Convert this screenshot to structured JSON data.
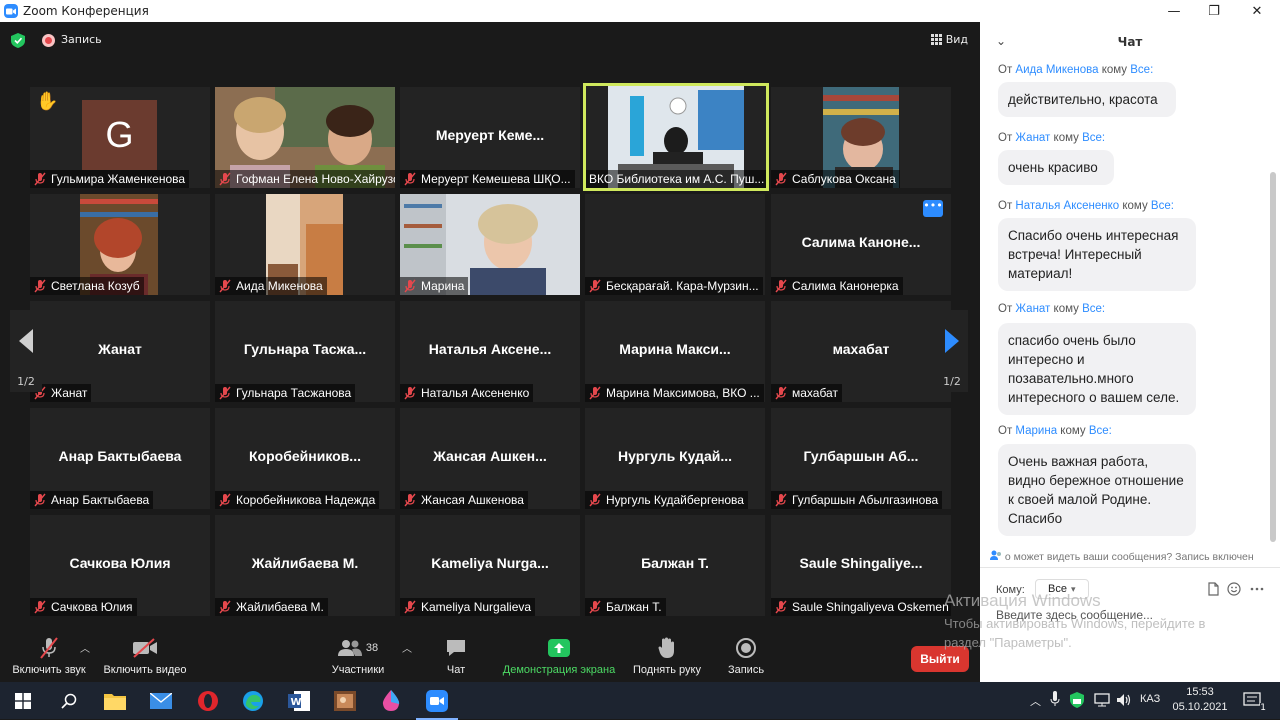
{
  "window": {
    "title": "Zoom Конференция",
    "minimize": "—",
    "maximize": "❐",
    "close": "✕"
  },
  "topbar": {
    "record_label": "Запись",
    "view_label": "Вид"
  },
  "tiles": [
    {
      "label": "Гульмира Жаменкенова",
      "avatar_letter": "G"
    },
    {
      "label": "Гофман Елена Ново-Хайрузо..."
    },
    {
      "big_name": "Меруерт Кеме...",
      "label": "Меруерт Кемешева ШҚО..."
    },
    {
      "label": "ВКО Библиотека им А.С. Пуш..."
    },
    {
      "label": "Саблукова Оксана"
    },
    {
      "label": "Светлана Козуб"
    },
    {
      "label": "Аида Микенова"
    },
    {
      "label": "Марина"
    },
    {
      "label": "Бесқарағай. Кара-Мурзин..."
    },
    {
      "big_name": "Салима Каноне...",
      "label": "Салима Канонерка"
    },
    {
      "big_name": "Жанат",
      "label": "Жанат"
    },
    {
      "big_name": "Гульнара Тасжа...",
      "label": "Гульнара Тасжанова"
    },
    {
      "big_name": "Наталья Аксене...",
      "label": "Наталья Аксененко"
    },
    {
      "big_name": "Марина Макси...",
      "label": "Марина Максимова, ВКО ..."
    },
    {
      "big_name": "махабат",
      "label": "махабат"
    },
    {
      "big_name": "Анар Бактыбаева",
      "label": "Анар Бактыбаева"
    },
    {
      "big_name": "Коробейников...",
      "label": "Коробейникова Надежда"
    },
    {
      "big_name": "Жансая Ашкен...",
      "label": "Жансая Ашкенова"
    },
    {
      "big_name": "Нургуль Кудай...",
      "label": "Нургуль Кудайбергенова"
    },
    {
      "big_name": "Гулбаршын Аб...",
      "label": "Гулбаршын Абылгазинова"
    },
    {
      "big_name": "Сачкова Юлия",
      "label": "Сачкова Юлия"
    },
    {
      "big_name": "Жайлибаева М.",
      "label": "Жайлибаева М."
    },
    {
      "big_name": "Kameliya Nurga...",
      "label": "Kameliya Nurgalieva"
    },
    {
      "big_name": "Балжан Т.",
      "label": "Балжан Т."
    },
    {
      "big_name": "Saule Shingaliye...",
      "label": "Saule Shingaliyeva Oskemen"
    }
  ],
  "pager": {
    "left": "1/2",
    "right": "1/2"
  },
  "toolbar": {
    "unmute": "Включить звук",
    "start_video": "Включить видео",
    "participants": "Участники",
    "participants_count": "38",
    "chat": "Чат",
    "share": "Демонстрация экрана",
    "raise_hand": "Поднять руку",
    "record": "Запись",
    "leave": "Выйти"
  },
  "chat": {
    "title": "Чат",
    "from": "От",
    "to_word": "кому",
    "everyone": "Все:",
    "messages": [
      {
        "sender": "Аида Микенова",
        "text": "действительно,  красота"
      },
      {
        "sender": "Жанат",
        "text": "очень красиво"
      },
      {
        "sender": "Наталья Аксененко",
        "text": "Спасибо очень интересная встреча! Интересный материал!"
      },
      {
        "sender": "Жанат",
        "text": "спасибо очень было интересно и позавательно.много интересного о вашем селе."
      },
      {
        "sender": "Марина",
        "text": "Очень важная работа, видно бережное отношение  к своей малой Родине. Спасибо"
      }
    ],
    "notice": "о может видеть ваши сообщения? Запись включен",
    "to_label": "Кому:",
    "to_value": "Все",
    "input_placeholder": "Введите здесь сообщение..."
  },
  "watermark": {
    "line1": "Активация Windows",
    "line2": "Чтобы активировать Windows, перейдите в раздел \"Параметры\"."
  },
  "taskbar": {
    "lang": "КАЗ",
    "time": "15:53",
    "date": "05.10.2021",
    "notif_count": "1"
  }
}
